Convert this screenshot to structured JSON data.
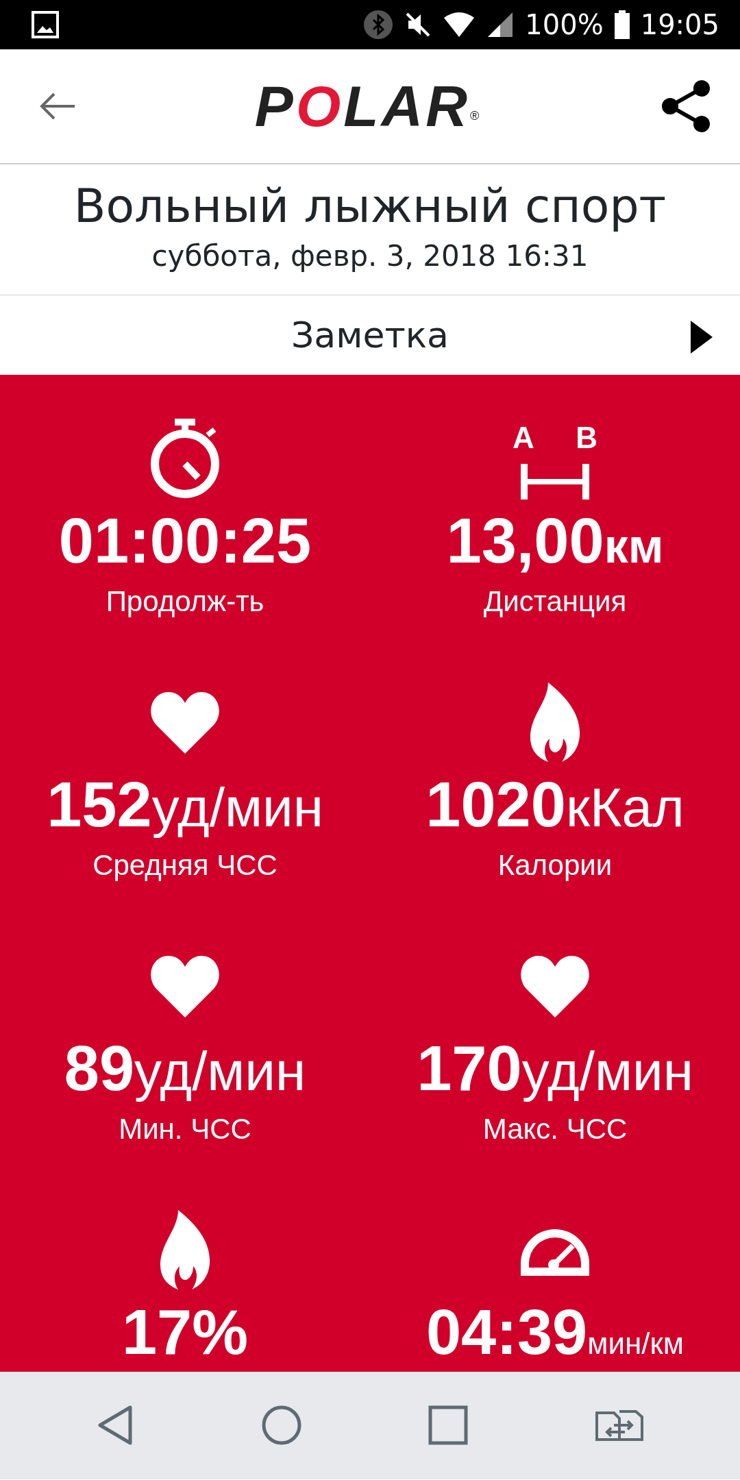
{
  "status_bar": {
    "battery": "100%",
    "time": "19:05"
  },
  "header": {
    "logo": "POLAR",
    "logo_mark": "®"
  },
  "workout": {
    "title": "Вольный лыжный спорт",
    "date": "суббота, февр. 3, 2018 16:31"
  },
  "note": {
    "label": "Заметка"
  },
  "distance_icon_markers": [
    "A",
    "B"
  ],
  "stats": [
    {
      "kind": "duration",
      "value": "01:00:25",
      "label": "Продолж-ть"
    },
    {
      "kind": "distance",
      "value": "13,00",
      "unit": "км",
      "label": "Дистанция"
    },
    {
      "kind": "heartrate",
      "value": "152",
      "unit": "уд/мин",
      "label": "Средняя ЧСС"
    },
    {
      "kind": "calories",
      "value": "1020",
      "unit": "кКал",
      "label": "Калории"
    },
    {
      "kind": "heartrate",
      "value": "89",
      "unit": "уд/мин",
      "label": "Мин. ЧСС"
    },
    {
      "kind": "heartrate",
      "value": "170",
      "unit": "уд/мин",
      "label": "Макс. ЧСС"
    },
    {
      "kind": "fatburn",
      "value": "17%"
    },
    {
      "kind": "pace",
      "value": "04:39",
      "unit": "мин/км"
    }
  ]
}
